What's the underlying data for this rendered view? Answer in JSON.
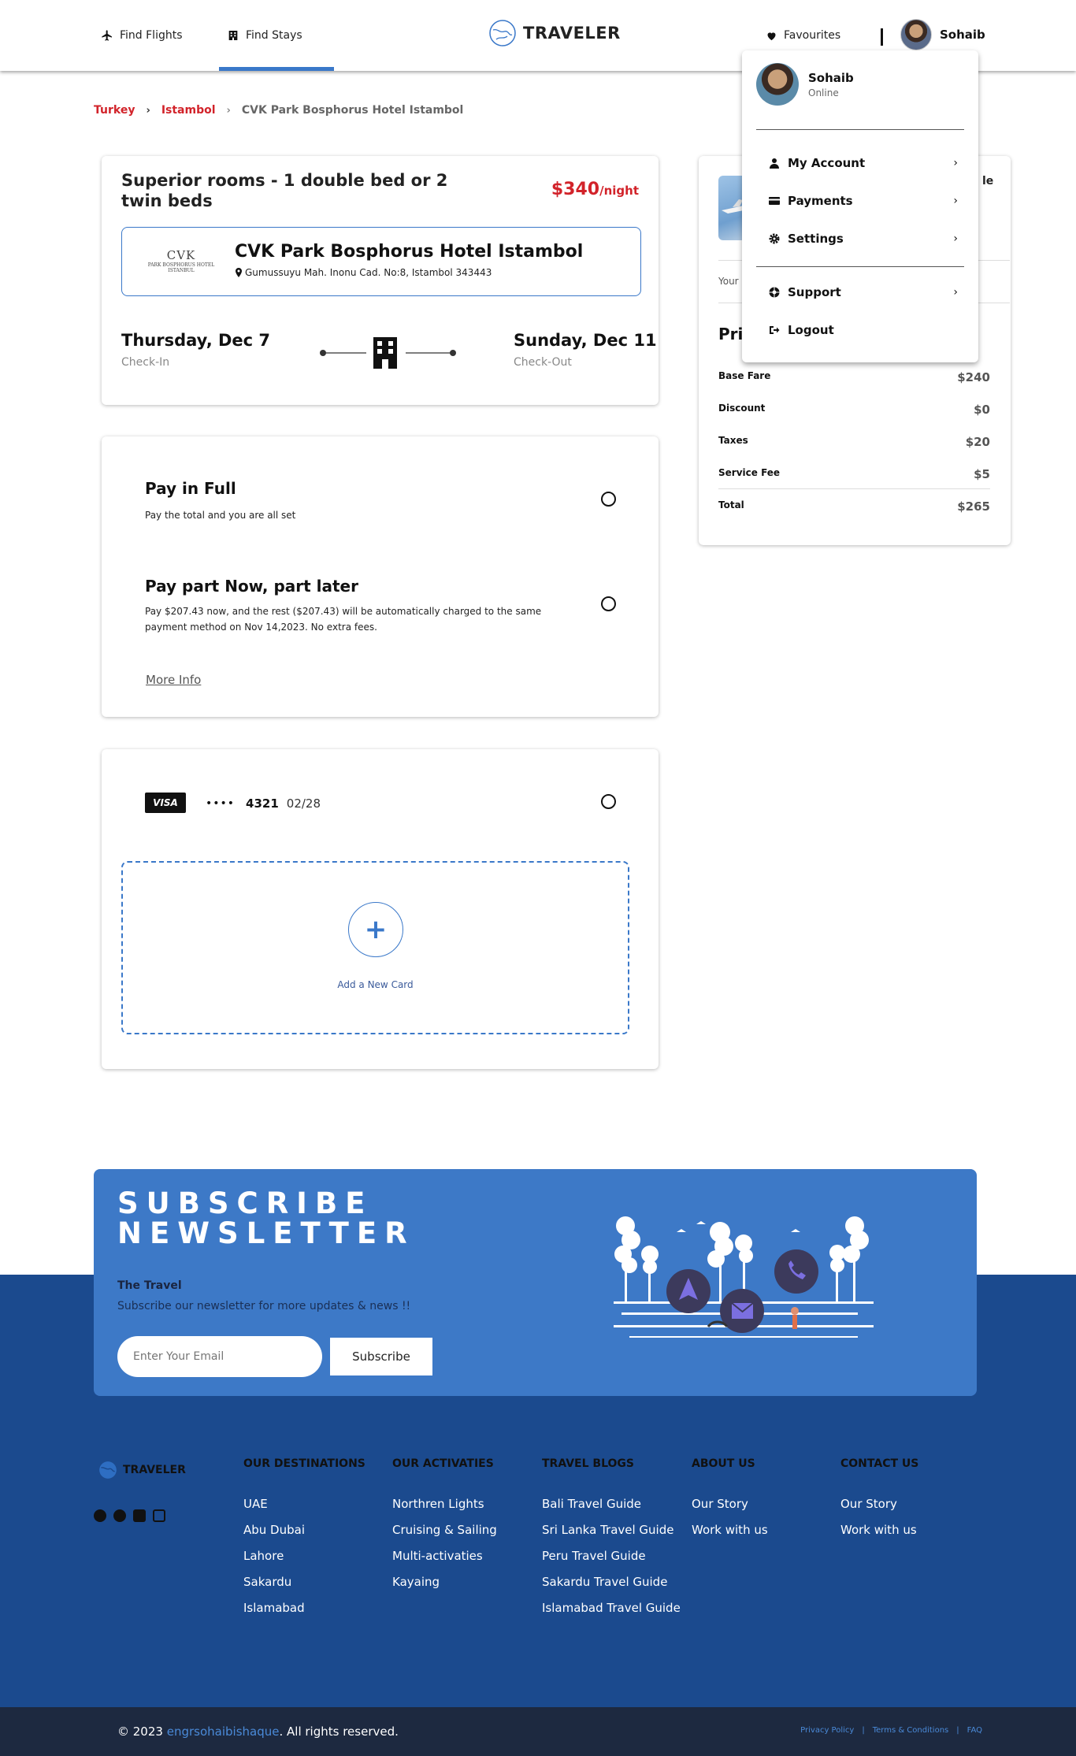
{
  "header": {
    "nav": [
      {
        "label": "Find Flights",
        "icon": "plane-icon"
      },
      {
        "label": "Find Stays",
        "icon": "building-icon"
      }
    ],
    "logo": "TRAVELER",
    "favourites": "Favourites",
    "user_name": "Sohaib"
  },
  "breadcrumb": [
    "Turkey",
    "Istambol",
    "CVK Park Bosphorus Hotel Istambol"
  ],
  "room": {
    "title": "Superior rooms - 1 double bed or 2 twin beds",
    "price": "$340",
    "price_unit": "/night",
    "hotel_logo_big": "CVK",
    "hotel_logo_small": "PARK BOSPHORUS HOTEL",
    "hotel_logo_city": "ISTANBUL",
    "hotel_name": "CVK Park Bosphorus Hotel Istambol",
    "hotel_address": "Gumussuyu Mah. Inonu Cad. No:8, Istambol 343443",
    "checkin_date": "Thursday, Dec 7",
    "checkin_label": "Check-In",
    "checkout_date": "Sunday, Dec 11",
    "checkout_label": "Check-Out"
  },
  "payment_options": {
    "full_title": "Pay in Full",
    "full_desc": "Pay the total and you are all set",
    "part_title": "Pay part Now, part later",
    "part_desc": "Pay $207.43 now, and the rest ($207.43) will be automatically charged to the same payment method on Nov 14,2023. No extra fees.",
    "more_info": "More Info"
  },
  "cards": {
    "brand": "VISA",
    "dots": "••••",
    "last4": "4321",
    "expiry": "02/28",
    "add_plus": "+",
    "add_label": "Add a New Card"
  },
  "summary": {
    "thumb_rest": "le",
    "your_label": "Your",
    "price_title": "Pri",
    "rows": [
      {
        "label": "Base Fare",
        "amount": "$240"
      },
      {
        "label": "Discount",
        "amount": "$0"
      },
      {
        "label": "Taxes",
        "amount": "$20"
      },
      {
        "label": "Service Fee",
        "amount": "$5"
      },
      {
        "label": "Total",
        "amount": "$265"
      }
    ]
  },
  "dropdown": {
    "name": "Sohaib",
    "status": "Online",
    "items": [
      {
        "label": "My Account",
        "icon": "user-icon"
      },
      {
        "label": "Payments",
        "icon": "credit-card-icon"
      },
      {
        "label": "Settings",
        "icon": "gear-icon"
      },
      {
        "label": "Support",
        "icon": "support-icon"
      },
      {
        "label": "Logout",
        "icon": "logout-icon"
      }
    ],
    "chevron": "›"
  },
  "newsletter": {
    "title_line1": "SUBSCRIBE",
    "title_line2": "NEWSLETTER",
    "subtitle": "The Travel",
    "desc": "Subscribe our newsletter for more updates & news !!",
    "placeholder": "Enter Your Email",
    "button": "Subscribe"
  },
  "footer": {
    "logo": "TRAVELER",
    "columns": [
      {
        "heading": "OUR DESTINATIONS",
        "links": [
          "UAE",
          "Abu Dubai",
          "Lahore",
          "Sakardu",
          "Islamabad"
        ]
      },
      {
        "heading": "OUR ACTIVATIES",
        "links": [
          "Northren Lights",
          "Cruising & Sailing",
          "Multi-activaties",
          "Kayaing"
        ]
      },
      {
        "heading": "TRAVEL BLOGS",
        "links": [
          "Bali Travel Guide",
          "Sri Lanka Travel Guide",
          "Peru Travel Guide",
          "Sakardu Travel Guide",
          "Islamabad Travel Guide"
        ]
      },
      {
        "heading": "ABOUT US",
        "links": [
          "Our Story",
          "Work with us"
        ]
      },
      {
        "heading": "CONTACT US",
        "links": [
          "Our Story",
          "Work with us"
        ]
      }
    ],
    "copyright_prefix": "© 2023",
    "copyright_name": "engrsohaibishaque",
    "copyright_suffix": ". All rights reserved.",
    "legal": [
      "Privacy Policy",
      "Terms & Conditions",
      "FAQ"
    ],
    "legal_sep": "|"
  },
  "colors": {
    "accent": "#3a78c9",
    "price_red": "#d2232a",
    "footer_blue": "#1b4a8e",
    "newsletter_blue": "#3d79c7"
  }
}
